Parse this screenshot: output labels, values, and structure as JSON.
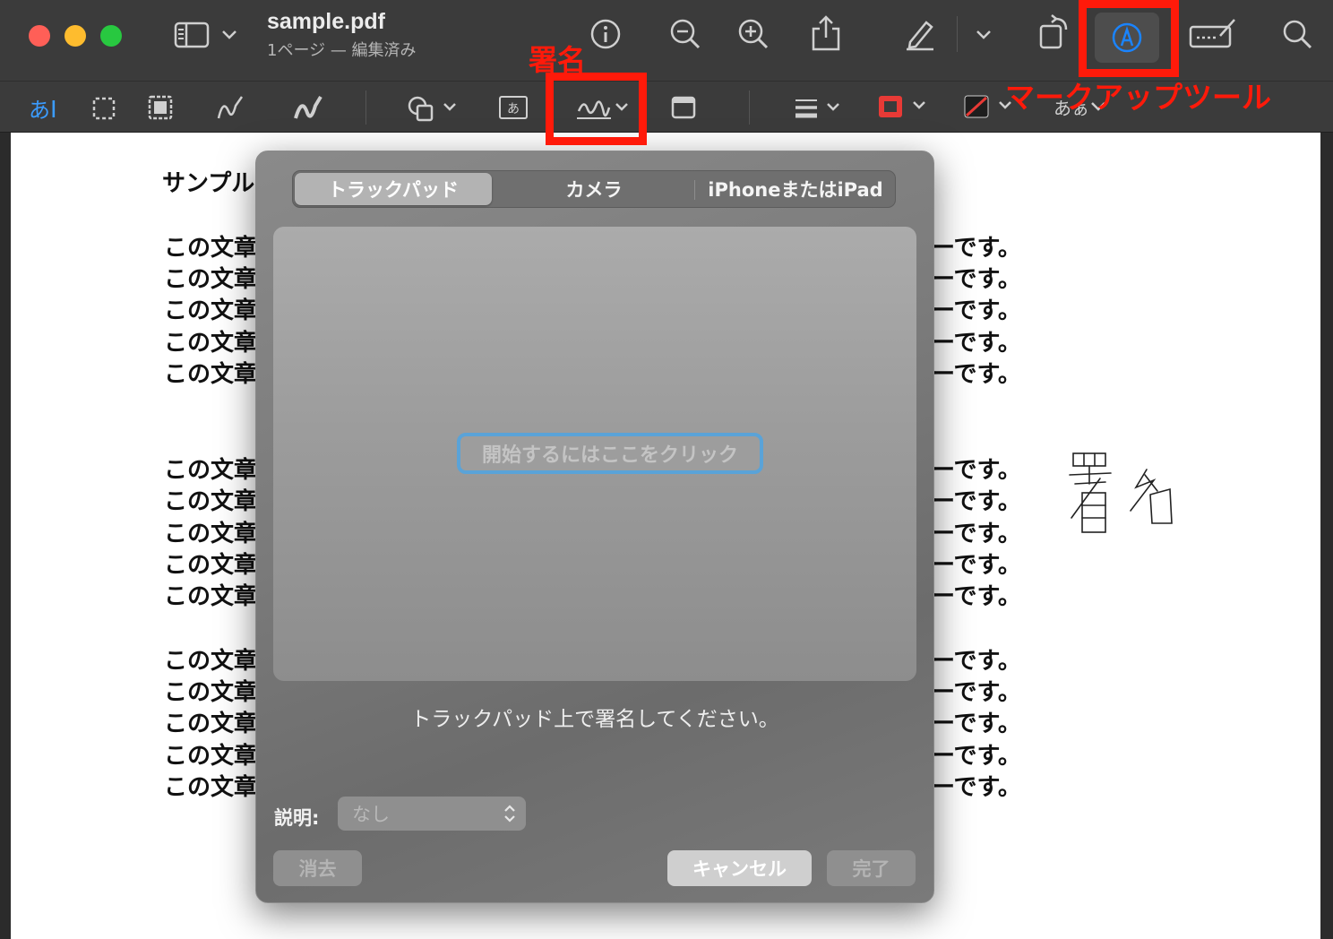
{
  "window": {
    "title": "sample.pdf",
    "subtitle": "1ページ — 編集済み"
  },
  "toolbar": {
    "icons": [
      "sidebar-icon",
      "chevron-down-icon",
      "info-icon",
      "zoom-out-icon",
      "zoom-in-icon",
      "share-icon",
      "highlight-pen-icon",
      "rotate-icon",
      "markup-icon",
      "form-fill-icon",
      "search-icon"
    ]
  },
  "markup_toolbar": {
    "text_selection_label": "あ",
    "tools": [
      "text-selection",
      "rect-selection",
      "smart-lasso",
      "sketch",
      "draw",
      "shapes",
      "text-box",
      "sign",
      "note",
      "shape-style",
      "border-color",
      "fill-color",
      "text-style"
    ],
    "text_style_label": "あぁ"
  },
  "document": {
    "heading_fragment": "サンプル",
    "line_left": "この文章",
    "line_right": "ーです。",
    "signature_text": "署名"
  },
  "annotations": {
    "sign_label": "署名",
    "markup_label": "マークアップツール",
    "color": "#ff1a0a"
  },
  "signature_dialog": {
    "tabs": [
      "トラックパッド",
      "カメラ",
      "iPhoneまたはiPad"
    ],
    "active_tab": 0,
    "start_button": "開始するにはここをクリック",
    "hint": "トラックパッド上で署名してください。",
    "description_label": "説明:",
    "description_value": "なし",
    "clear_button": "消去",
    "cancel_button": "キャンセル",
    "done_button": "完了"
  },
  "colors": {
    "accent": "#1a84ff",
    "titlebar": "#3b3b3b",
    "close": "#ff5f57",
    "minimize": "#febc2e",
    "zoom": "#28c840"
  }
}
